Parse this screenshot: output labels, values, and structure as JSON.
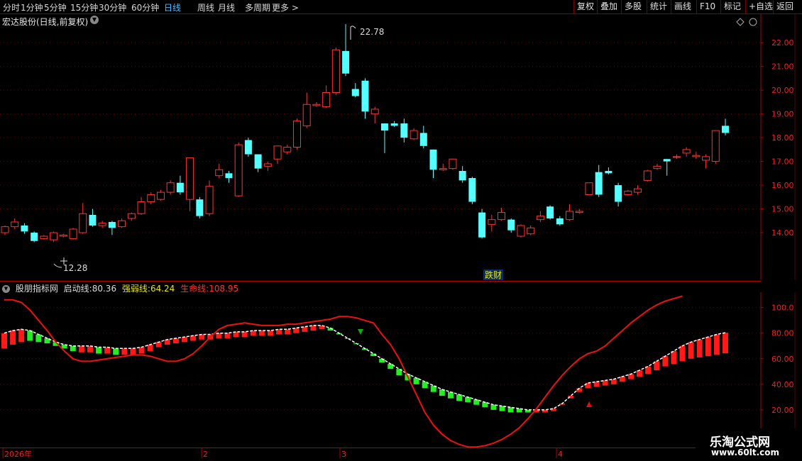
{
  "toolbar": {
    "periods": [
      "分时",
      "1分钟",
      "5分钟",
      "15分钟",
      "30分钟",
      "60分钟",
      "日线",
      "周线",
      "月线",
      "多周期",
      "更多 >"
    ],
    "active_period": "日线",
    "right_buttons": [
      "复权",
      "叠加",
      "多股",
      "统计",
      "画线",
      "F10",
      "标记",
      "+自选",
      "返回"
    ]
  },
  "main_chart": {
    "title": "宏达股份(日线,前复权)",
    "high_label": "22.78",
    "low_label": "12.28",
    "event_badge": "跌财",
    "y_ticks": [
      "22.00",
      "21.00",
      "20.00",
      "19.00",
      "18.00",
      "17.00",
      "16.00",
      "15.00",
      "14.00"
    ]
  },
  "indicator": {
    "name": "股朋指标网",
    "line1_label": "启动线:",
    "line1_value": "80.36",
    "line2_label": "强弱线:",
    "line2_value": "64.24",
    "line3_label": "生命线:",
    "line3_value": "108.95",
    "y_ticks": [
      "100.0",
      "80.00",
      "60.00",
      "40.00",
      "20.00"
    ],
    "colors": {
      "line1": "#dddddd",
      "line2": "#e8e800",
      "line3": "#ff3030"
    }
  },
  "x_axis": {
    "labels": [
      "2026年",
      "2",
      "3",
      "4"
    ]
  },
  "watermark": {
    "line1": "乐淘公式网",
    "line2": "www.60lt.com"
  },
  "chart_data": [
    {
      "type": "candlestick",
      "title": "宏达股份(日线,前复权)",
      "ylim": [
        12.0,
        23.2
      ],
      "candles": [
        [
          14.0,
          14.25,
          13.9,
          14.3
        ],
        [
          14.25,
          14.45,
          14.15,
          14.6
        ],
        [
          14.3,
          14.05,
          13.95,
          14.4
        ],
        [
          14.0,
          13.65,
          13.6,
          14.05
        ],
        [
          13.75,
          13.85,
          13.7,
          13.9
        ],
        [
          13.7,
          14.0,
          13.6,
          14.05
        ],
        [
          13.85,
          13.9,
          13.8,
          13.95
        ],
        [
          13.75,
          14.15,
          13.7,
          14.2
        ],
        [
          14.0,
          14.8,
          13.95,
          15.25
        ],
        [
          14.75,
          14.3,
          14.25,
          15.0
        ],
        [
          14.3,
          14.4,
          14.2,
          14.5
        ],
        [
          14.45,
          14.2,
          13.9,
          14.5
        ],
        [
          14.25,
          14.5,
          14.2,
          14.6
        ],
        [
          14.6,
          14.8,
          14.5,
          14.85
        ],
        [
          14.8,
          15.3,
          14.75,
          15.5
        ],
        [
          15.3,
          15.6,
          15.2,
          15.7
        ],
        [
          15.4,
          15.7,
          15.35,
          15.8
        ],
        [
          15.7,
          16.1,
          15.6,
          16.2
        ],
        [
          16.1,
          15.7,
          15.6,
          16.4
        ],
        [
          15.4,
          17.15,
          14.9,
          17.15
        ],
        [
          15.4,
          14.7,
          14.6,
          15.5
        ],
        [
          14.8,
          15.95,
          14.7,
          16.2
        ],
        [
          16.4,
          16.65,
          16.3,
          16.9
        ],
        [
          16.5,
          16.3,
          16.1,
          16.6
        ],
        [
          15.55,
          17.7,
          15.5,
          17.8
        ],
        [
          17.9,
          17.3,
          17.2,
          18.0
        ],
        [
          17.3,
          16.7,
          16.55,
          17.3
        ],
        [
          16.8,
          16.9,
          16.6,
          17.0
        ],
        [
          17.1,
          17.65,
          16.9,
          17.65
        ],
        [
          17.4,
          17.6,
          17.3,
          17.7
        ],
        [
          17.6,
          18.7,
          17.5,
          18.8
        ],
        [
          18.5,
          19.4,
          18.4,
          19.9
        ],
        [
          19.35,
          19.4,
          19.3,
          19.5
        ],
        [
          19.3,
          19.9,
          19.25,
          20.2
        ],
        [
          19.9,
          21.7,
          19.8,
          21.8
        ],
        [
          21.65,
          20.7,
          20.6,
          22.78
        ],
        [
          20.05,
          19.75,
          19.7,
          20.3
        ],
        [
          20.4,
          19.1,
          18.8,
          20.5
        ],
        [
          19.0,
          19.2,
          18.6,
          19.3
        ],
        [
          18.6,
          18.3,
          17.35,
          18.6
        ],
        [
          18.6,
          18.5,
          18.45,
          18.7
        ],
        [
          18.6,
          18.0,
          17.8,
          18.8
        ],
        [
          17.95,
          18.3,
          17.9,
          18.4
        ],
        [
          18.2,
          17.65,
          17.55,
          18.5
        ],
        [
          17.5,
          16.65,
          16.3,
          17.5
        ],
        [
          16.65,
          16.7,
          16.6,
          16.9
        ],
        [
          16.7,
          17.1,
          16.65,
          17.1
        ],
        [
          16.6,
          16.2,
          16.1,
          16.8
        ],
        [
          16.3,
          15.3,
          15.2,
          16.35
        ],
        [
          14.85,
          13.8,
          13.75,
          15.0
        ],
        [
          14.35,
          14.55,
          14.05,
          14.75
        ],
        [
          14.55,
          14.85,
          14.5,
          15.05
        ],
        [
          14.55,
          14.1,
          14.0,
          14.6
        ],
        [
          13.85,
          14.3,
          13.8,
          14.35
        ],
        [
          13.95,
          14.2,
          13.9,
          14.3
        ],
        [
          14.55,
          14.7,
          14.45,
          14.9
        ],
        [
          15.1,
          14.6,
          14.55,
          15.15
        ],
        [
          14.6,
          14.35,
          14.3,
          14.7
        ],
        [
          14.55,
          14.9,
          14.5,
          15.2
        ],
        [
          14.85,
          14.9,
          14.8,
          15.0
        ],
        [
          15.6,
          16.1,
          15.6,
          16.1
        ],
        [
          16.55,
          15.6,
          15.5,
          16.85
        ],
        [
          16.6,
          16.5,
          16.45,
          16.75
        ],
        [
          16.0,
          15.3,
          15.1,
          16.1
        ],
        [
          15.6,
          15.75,
          15.55,
          15.8
        ],
        [
          15.7,
          15.85,
          15.6,
          16.0
        ],
        [
          16.2,
          16.6,
          16.15,
          16.65
        ],
        [
          16.7,
          16.8,
          16.65,
          16.9
        ],
        [
          17.1,
          17.0,
          16.4,
          17.1
        ],
        [
          17.2,
          17.2,
          17.1,
          17.3
        ],
        [
          17.35,
          17.5,
          17.2,
          17.6
        ],
        [
          17.2,
          17.25,
          17.1,
          17.4
        ],
        [
          17.05,
          17.2,
          16.7,
          17.3
        ],
        [
          17.0,
          18.3,
          16.9,
          18.3
        ],
        [
          18.5,
          18.2,
          18.1,
          18.8
        ]
      ]
    },
    {
      "type": "line",
      "title": "股朋指标网",
      "ylim": [
        -10,
        112
      ],
      "series": [
        {
          "name": "启动线",
          "values": [
            80,
            82,
            83,
            82,
            79,
            76,
            73,
            71,
            70,
            70,
            70,
            69,
            69,
            68,
            68,
            68,
            69,
            71,
            73,
            75,
            76,
            77,
            78,
            79,
            79,
            80,
            80,
            81,
            81,
            82,
            82,
            82,
            83,
            83,
            84,
            85,
            86,
            86,
            84,
            80,
            76,
            72,
            68,
            64,
            60,
            56,
            52,
            48,
            45,
            42,
            39,
            36,
            34,
            32,
            30,
            28,
            26,
            24,
            23,
            22,
            21,
            20,
            20,
            20,
            21,
            25,
            31,
            37,
            41,
            42,
            43,
            44,
            46,
            48,
            51,
            54,
            58,
            62,
            66,
            70,
            73,
            75,
            77,
            79,
            80.36
          ]
        },
        {
          "name": "强弱线",
          "values": [
            68,
            71,
            73,
            74,
            73,
            72,
            70,
            68,
            66,
            65,
            65,
            64,
            64,
            63,
            63,
            63,
            64,
            66,
            69,
            71,
            72,
            73,
            74,
            75,
            75,
            76,
            76,
            77,
            77,
            78,
            78,
            78,
            79,
            79,
            80,
            81,
            82,
            83,
            82,
            79,
            76,
            72,
            67,
            62,
            57,
            52,
            47,
            43,
            40,
            37,
            34,
            31,
            29,
            27,
            26,
            24,
            22,
            20,
            19,
            18,
            18,
            18,
            18,
            18,
            19,
            24,
            29,
            34,
            37,
            38,
            39,
            40,
            42,
            44,
            46,
            48,
            51,
            54,
            56,
            58,
            60,
            61,
            62,
            63,
            64.24
          ]
        },
        {
          "name": "生命线",
          "values": [
            106,
            106,
            104,
            98,
            90,
            82,
            73,
            66,
            60,
            58,
            58,
            59,
            60,
            61,
            62,
            63,
            63,
            62,
            60,
            58,
            58,
            60,
            64,
            70,
            77,
            83,
            86,
            87,
            88,
            87,
            86,
            86,
            86,
            87,
            87,
            88,
            89,
            90,
            91,
            93,
            93,
            92,
            90,
            88,
            79,
            71,
            60,
            46,
            32,
            18,
            8,
            1,
            -4,
            -7,
            -9,
            -9,
            -8,
            -6,
            -3,
            1,
            6,
            13,
            21,
            30,
            39,
            47,
            54,
            60,
            64,
            66,
            70,
            76,
            82,
            88,
            93,
            98,
            102,
            105,
            107,
            108.95
          ]
        }
      ]
    }
  ]
}
